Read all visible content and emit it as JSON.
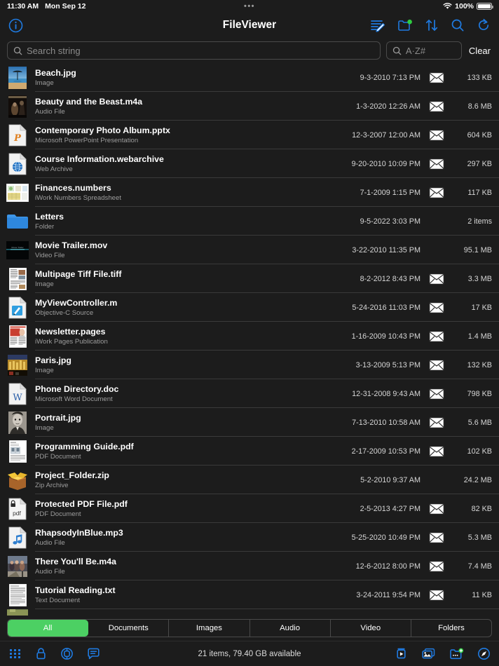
{
  "statusbar": {
    "time": "11:30 AM",
    "date": "Mon Sep 12",
    "dots": "•••",
    "battery_percent": "100%"
  },
  "navbar": {
    "title": "FileViewer",
    "info_icon": "info-circle-icon",
    "actions": [
      {
        "name": "edit-list-icon",
        "label": "Edit"
      },
      {
        "name": "new-folder-icon",
        "label": "New Folder"
      },
      {
        "name": "sort-icon",
        "label": "Sort"
      },
      {
        "name": "search-icon",
        "label": "Search"
      },
      {
        "name": "refresh-icon",
        "label": "Refresh"
      }
    ]
  },
  "search": {
    "placeholder": "Search string",
    "value": "",
    "az_placeholder": "A·Z#",
    "az_value": "",
    "clear_label": "Clear"
  },
  "files": [
    {
      "name": "Beach.jpg",
      "kind": "Image",
      "date": "9-3-2010 7:13 PM",
      "size": "133 KB",
      "mail": true,
      "icon": "photo-beach-thumbnail"
    },
    {
      "name": "Beauty and the Beast.m4a",
      "kind": "Audio File",
      "date": "1-3-2020 12:26 AM",
      "size": "8.6 MB",
      "mail": true,
      "icon": "album-art-thumbnail"
    },
    {
      "name": "Contemporary Photo Album.pptx",
      "kind": "Microsoft PowerPoint Presentation",
      "date": "12-3-2007 12:00 AM",
      "size": "604 KB",
      "mail": true,
      "icon": "powerpoint-doc-icon"
    },
    {
      "name": "Course Information.webarchive",
      "kind": "Web Archive",
      "date": "9-20-2010 10:09 PM",
      "size": "297 KB",
      "mail": true,
      "icon": "webarchive-globe-icon"
    },
    {
      "name": "Finances.numbers",
      "kind": "iWork Numbers Spreadsheet",
      "date": "7-1-2009 1:15 PM",
      "size": "117 KB",
      "mail": true,
      "icon": "numbers-spreadsheet-thumbnail"
    },
    {
      "name": "Letters",
      "kind": "Folder",
      "date": "9-5-2022 3:03 PM",
      "size": "2 items",
      "mail": false,
      "icon": "folder-icon"
    },
    {
      "name": "Movie Trailer.mov",
      "kind": "Video File",
      "date": "3-22-2010 11:35 PM",
      "size": "95.1 MB",
      "mail": false,
      "icon": "movie-frame-thumbnail"
    },
    {
      "name": "Multipage Tiff File.tiff",
      "kind": "Image",
      "date": "8-2-2012 8:43 PM",
      "size": "3.3 MB",
      "mail": true,
      "icon": "page-scan-thumbnail"
    },
    {
      "name": "MyViewController.m",
      "kind": "Objective-C Source",
      "date": "5-24-2016 11:03 PM",
      "size": "17 KB",
      "mail": true,
      "icon": "xcode-source-icon"
    },
    {
      "name": "Newsletter.pages",
      "kind": "iWork Pages Publication",
      "date": "1-16-2009 10:43 PM",
      "size": "1.4 MB",
      "mail": true,
      "icon": "pages-newsletter-thumbnail"
    },
    {
      "name": "Paris.jpg",
      "kind": "Image",
      "date": "3-13-2009 5:13 PM",
      "size": "132 KB",
      "mail": true,
      "icon": "photo-paris-thumbnail"
    },
    {
      "name": "Phone Directory.doc",
      "kind": "Microsoft Word Document",
      "date": "12-31-2008 9:43 AM",
      "size": "798 KB",
      "mail": true,
      "icon": "word-doc-icon"
    },
    {
      "name": "Portrait.jpg",
      "kind": "Image",
      "date": "7-13-2010 10:58 AM",
      "size": "5.6 MB",
      "mail": true,
      "icon": "photo-portrait-thumbnail"
    },
    {
      "name": "Programming Guide.pdf",
      "kind": "PDF Document",
      "date": "2-17-2009 10:53 PM",
      "size": "102 KB",
      "mail": true,
      "icon": "pdf-page-thumbnail"
    },
    {
      "name": "Project_Folder.zip",
      "kind": "Zip Archive",
      "date": "5-2-2010 9:37 AM",
      "size": "24.2 MB",
      "mail": false,
      "icon": "zip-archive-box-icon"
    },
    {
      "name": "Protected PDF File.pdf",
      "kind": "PDF Document",
      "date": "2-5-2013 4:27 PM",
      "size": "82 KB",
      "mail": true,
      "icon": "locked-pdf-icon"
    },
    {
      "name": "RhapsodyInBlue.mp3",
      "kind": "Audio File",
      "date": "5-25-2020 10:49 PM",
      "size": "5.3 MB",
      "mail": true,
      "icon": "music-note-doc-icon"
    },
    {
      "name": "There You'll Be.m4a",
      "kind": "Audio File",
      "date": "12-6-2012 8:00 PM",
      "size": "7.4 MB",
      "mail": true,
      "icon": "album-art-people-thumbnail"
    },
    {
      "name": "Tutorial Reading.txt",
      "kind": "Text Document",
      "date": "3-24-2011 9:54 PM",
      "size": "11 KB",
      "mail": true,
      "icon": "text-page-thumbnail"
    }
  ],
  "segments": [
    {
      "label": "All",
      "active": true
    },
    {
      "label": "Documents",
      "active": false
    },
    {
      "label": "Images",
      "active": false
    },
    {
      "label": "Audio",
      "active": false
    },
    {
      "label": "Video",
      "active": false
    },
    {
      "label": "Folders",
      "active": false
    }
  ],
  "toolbar": {
    "status": "21 items, 79.40 GB available",
    "left_icons": [
      {
        "name": "grid-apps-icon"
      },
      {
        "name": "lock-icon"
      },
      {
        "name": "lifebuoy-icon"
      },
      {
        "name": "chat-bubble-icon"
      }
    ],
    "right_icons": [
      {
        "name": "video-play-icon"
      },
      {
        "name": "photos-icon"
      },
      {
        "name": "add-folder-icon"
      },
      {
        "name": "compass-icon"
      }
    ]
  },
  "colors": {
    "accent": "#1f7ae0",
    "active_segment": "#4cd063",
    "background": "#1c1c1c",
    "separator": "#3a3a3a",
    "badge_green": "#2ecc40"
  }
}
